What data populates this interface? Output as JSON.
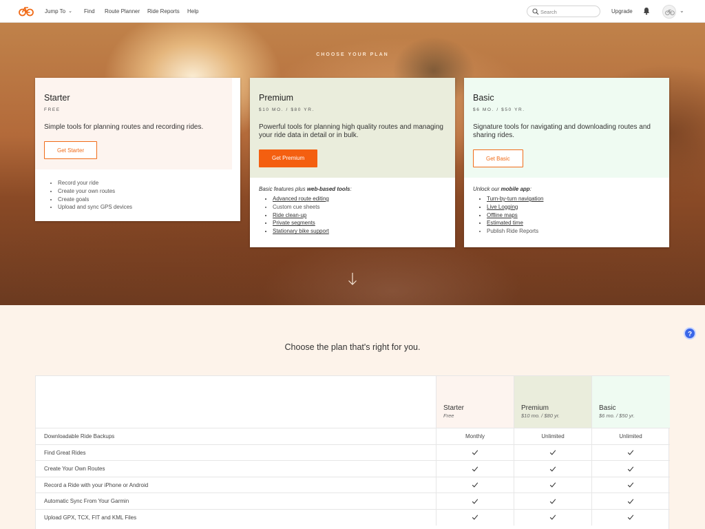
{
  "nav": {
    "links": [
      "Jump To",
      "Find",
      "Route Planner",
      "Ride Reports",
      "Help"
    ],
    "search_placeholder": "Search",
    "upgrade": "Upgrade"
  },
  "hero": {
    "title": "CHOOSE YOUR PLAN"
  },
  "plans": [
    {
      "name": "Starter",
      "price": "FREE",
      "desc": "Simple tools for planning routes and recording rides.",
      "button": "Get Starter",
      "intro": "",
      "features": [
        "Record your ride",
        "Create your own routes",
        "Create goals",
        "Upload and sync GPS devices"
      ],
      "color": "#fdf4ef"
    },
    {
      "name": "Premium",
      "price": "$10 MO. / $80 YR.",
      "desc": "Powerful tools for planning high quality routes and managing your ride data in detail or in bulk.",
      "button": "Get Premium",
      "intro_plain": "Basic features plus ",
      "intro_bold": "web-based tools",
      "intro_end": ":",
      "features": [
        "Advanced route editing",
        "Custom cue sheets",
        "Ride clean-up",
        "Private segments",
        "Stationary bike support"
      ],
      "color": "#eaeddc"
    },
    {
      "name": "Basic",
      "price": "$6 MO. / $50 YR.",
      "desc": "Signature tools for navigating and downloading routes and sharing rides.",
      "button": "Get Basic",
      "intro_plain": "Unlock our ",
      "intro_bold": "mobile app",
      "intro_end": ":",
      "features": [
        "Turn-by-turn navigation",
        "Live Logging",
        "Offline maps",
        "Estimated time",
        "Publish Ride Reports"
      ],
      "color": "#effbf2"
    }
  ],
  "compare": {
    "title": "Choose the plan that's right for you.",
    "columns": [
      {
        "name": "Starter",
        "price": "Free"
      },
      {
        "name": "Premium",
        "price": "$10 mo. / $80 yr."
      },
      {
        "name": "Basic",
        "price": "$6 mo. / $50 yr."
      }
    ],
    "rows": [
      {
        "feature": "Downloadable Ride Backups",
        "values": [
          "Monthly",
          "Unlimited",
          "Unlimited"
        ]
      },
      {
        "feature": "Find Great Rides",
        "values": [
          "check",
          "check",
          "check"
        ]
      },
      {
        "feature": "Create Your Own Routes",
        "values": [
          "check",
          "check",
          "check"
        ]
      },
      {
        "feature": "Record a Ride with your iPhone or Android",
        "values": [
          "check",
          "check",
          "check"
        ]
      },
      {
        "feature": "Automatic Sync From Your Garmin",
        "values": [
          "check",
          "check",
          "check"
        ]
      },
      {
        "feature": "Upload GPX, TCX, FIT and KML Files",
        "values": [
          "check",
          "check",
          "check"
        ]
      }
    ]
  },
  "help_label": "?"
}
